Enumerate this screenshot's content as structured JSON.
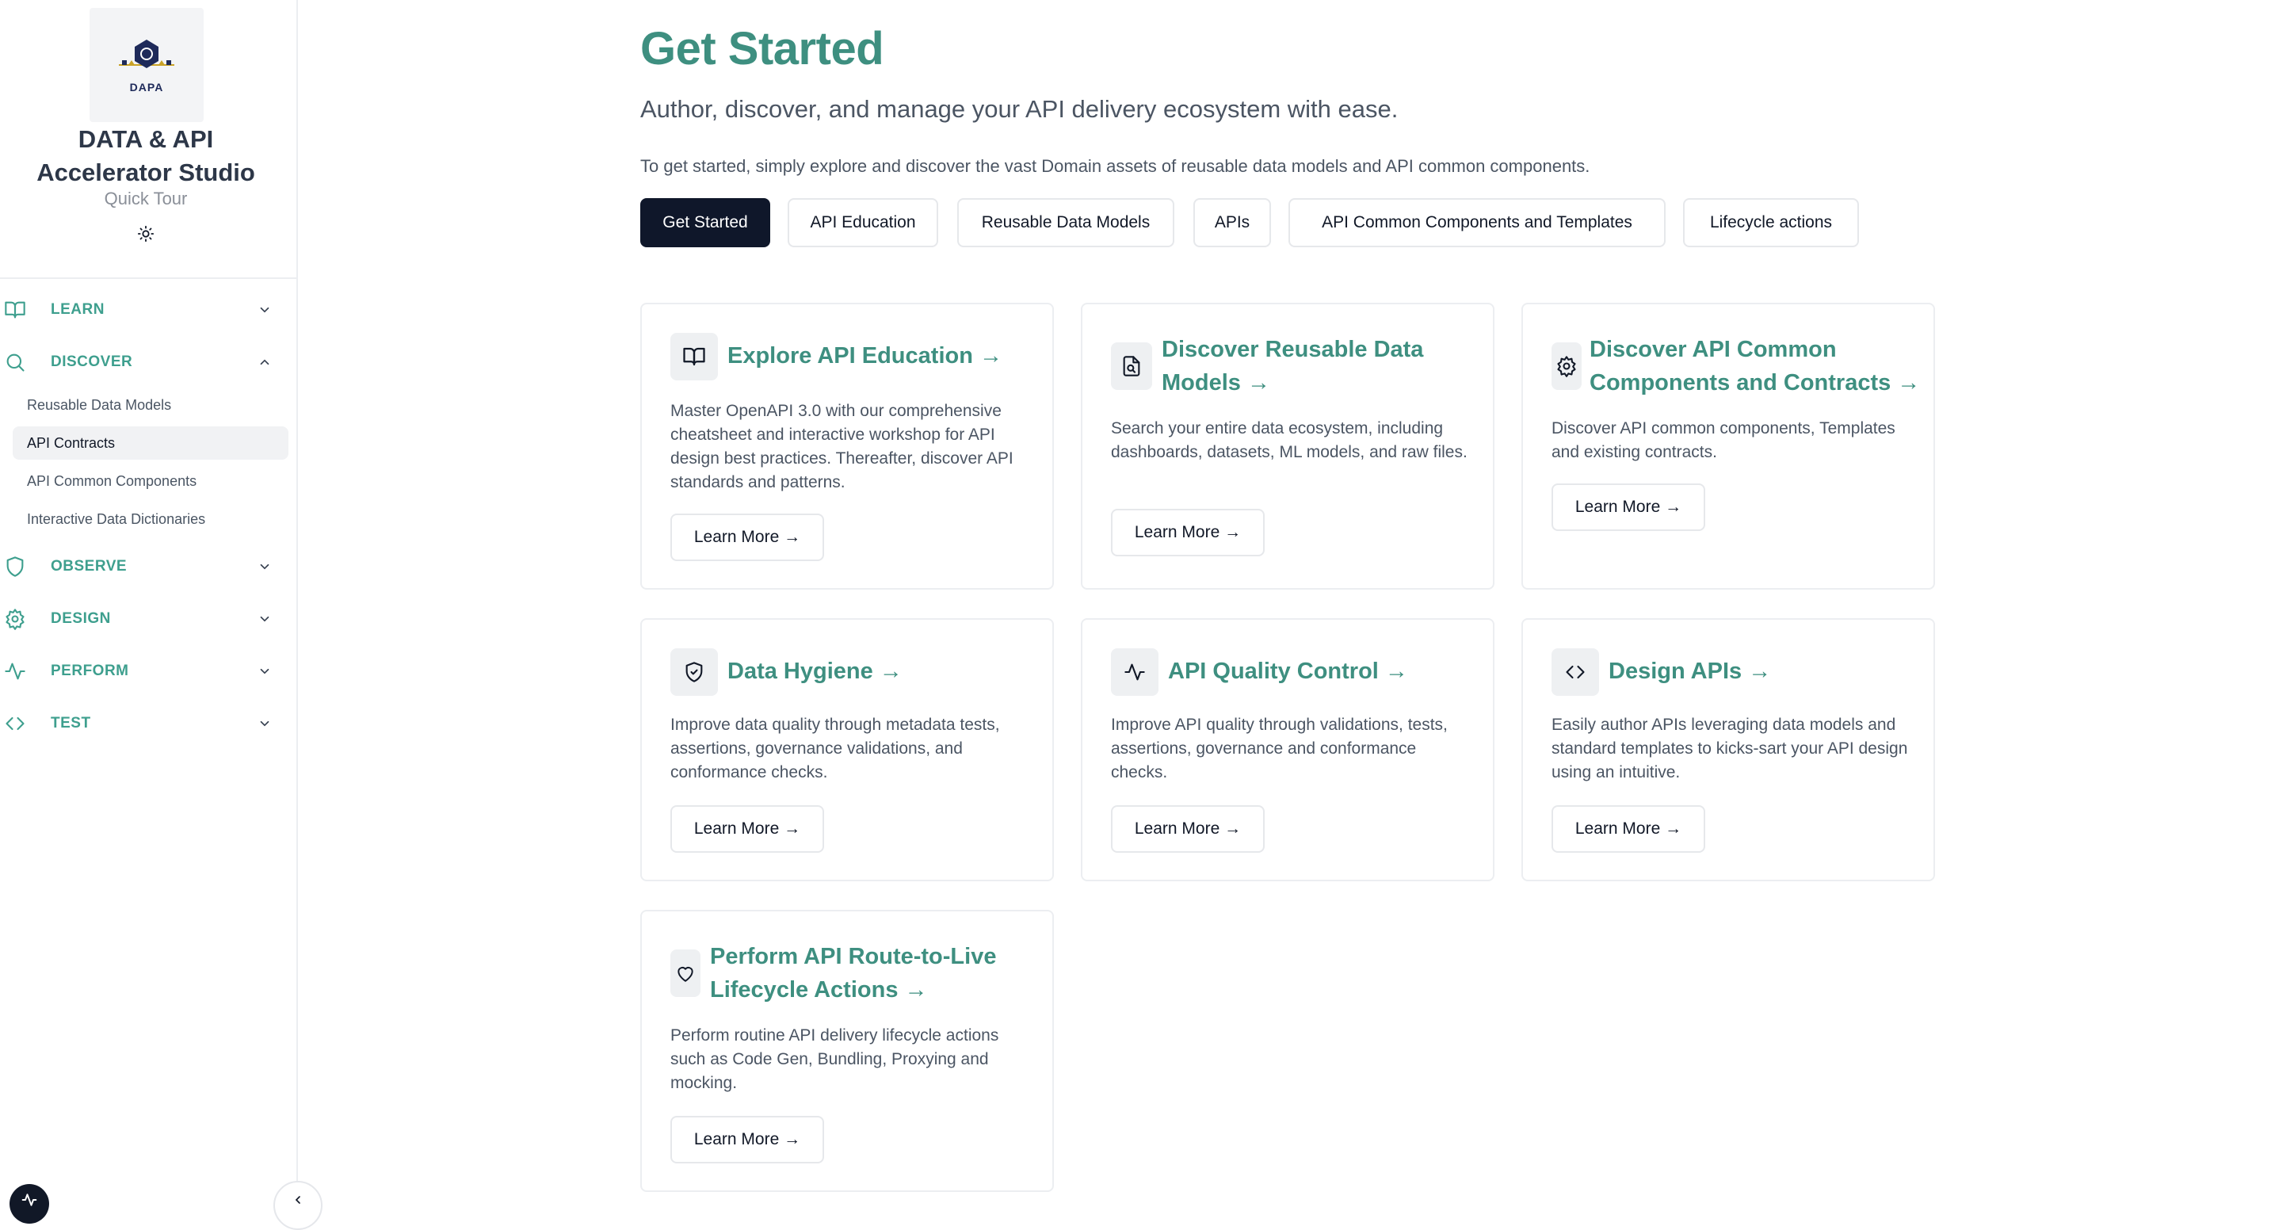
{
  "sidebar": {
    "logo_text": "DAPA",
    "brand_title_line1": "DATA & API",
    "brand_title_line2": "Accelerator Studio",
    "brand_subtitle": "Quick Tour",
    "theme_icon": "sun-icon",
    "sections": [
      {
        "label": "LEARN",
        "icon": "book-open-icon",
        "expanded": false
      },
      {
        "label": "DISCOVER",
        "icon": "search-icon",
        "expanded": true
      },
      {
        "label": "OBSERVE",
        "icon": "shield-icon",
        "expanded": false
      },
      {
        "label": "DESIGN",
        "icon": "gear-icon",
        "expanded": false
      },
      {
        "label": "PERFORM",
        "icon": "activity-icon",
        "expanded": false
      },
      {
        "label": "TEST",
        "icon": "code-icon",
        "expanded": false
      }
    ],
    "discover_items": [
      {
        "label": "Reusable Data Models",
        "active": false
      },
      {
        "label": "API Contracts",
        "active": true
      },
      {
        "label": "API Common Components",
        "active": false
      },
      {
        "label": "Interactive Data Dictionaries",
        "active": false
      }
    ]
  },
  "hero": {
    "title": "Get Started",
    "subtitle": "Author, discover, and manage your API delivery ecosystem with ease.",
    "description": "To get started, simply explore and discover the vast Domain assets of reusable data models and API common components."
  },
  "tabs": [
    {
      "label": "Get Started",
      "active": true
    },
    {
      "label": "API Education",
      "active": false
    },
    {
      "label": "Reusable Data Models",
      "active": false
    },
    {
      "label": "APIs",
      "active": false
    },
    {
      "label": "API Common Components and Templates",
      "active": false
    },
    {
      "label": "Lifecycle actions",
      "active": false
    }
  ],
  "cards": [
    {
      "icon": "book-open-icon",
      "title_line1": "Explore API Education →",
      "title_line2": "",
      "description": "Master OpenAPI 3.0 with our comprehensive cheatsheet and interactive workshop for API design best practices. Thereafter, discover API standards and patterns.",
      "button": "Learn More →"
    },
    {
      "icon": "file-search-icon",
      "title_line1": "Discover Reusable Data",
      "title_line2": "Models →",
      "description": "Search your entire data ecosystem, including dashboards, datasets, ML models, and raw files.",
      "button": "Learn More →"
    },
    {
      "icon": "gear-icon",
      "title_line1": "Discover API Common",
      "title_line2": "Components and Contracts →",
      "description": "Discover API common components, Templates and existing contracts.",
      "button": "Learn More →"
    },
    {
      "icon": "shield-check-icon",
      "title_line1": "Data Hygiene →",
      "title_line2": "",
      "description": "Improve data quality through metadata tests, assertions, governance validations, and conformance checks.",
      "button": "Learn More →"
    },
    {
      "icon": "activity-icon",
      "title_line1": "API Quality Control →",
      "title_line2": "",
      "description": "Improve API quality through validations, tests, assertions, governance and conformance checks.",
      "button": "Learn More →"
    },
    {
      "icon": "code-icon",
      "title_line1": "Design APIs →",
      "title_line2": "",
      "description": "Easily author APIs leveraging data models and standard templates to kicks-sart your API design using an intuitive.",
      "button": "Learn More →"
    },
    {
      "icon": "heart-icon",
      "title_line1": "Perform API Route-to-Live",
      "title_line2": "Lifecycle Actions →",
      "description": "Perform routine API delivery lifecycle actions such as Code Gen, Bundling, Proxying and mocking.",
      "button": "Learn More →"
    }
  ],
  "colors": {
    "accent": "#3e8f80",
    "nav_accent": "#3e9f8e",
    "dark": "#0f172a"
  }
}
